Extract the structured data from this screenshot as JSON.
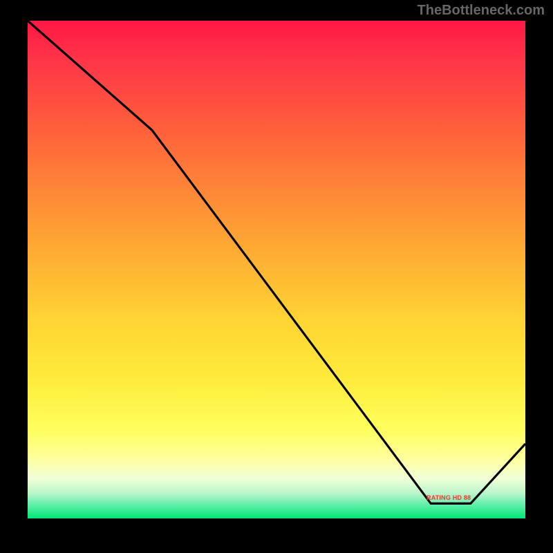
{
  "watermark": "TheBottleneck.com",
  "annotation_label": "RATING HD 88",
  "chart_data": {
    "type": "line",
    "title": "",
    "xlabel": "",
    "ylabel": "",
    "xlim": [
      0,
      100
    ],
    "ylim": [
      0,
      100
    ],
    "series": [
      {
        "name": "curve",
        "points": [
          {
            "x": 0,
            "y": 100
          },
          {
            "x": 25,
            "y": 78
          },
          {
            "x": 81,
            "y": 3
          },
          {
            "x": 89,
            "y": 3
          },
          {
            "x": 100,
            "y": 15
          }
        ]
      }
    ],
    "annotation": {
      "x": 85,
      "y": 4,
      "text": "RATING HD 88"
    },
    "background_gradient": {
      "top": "#ff1744",
      "mid": "#ffeb3b",
      "bottom": "#00e676"
    }
  }
}
